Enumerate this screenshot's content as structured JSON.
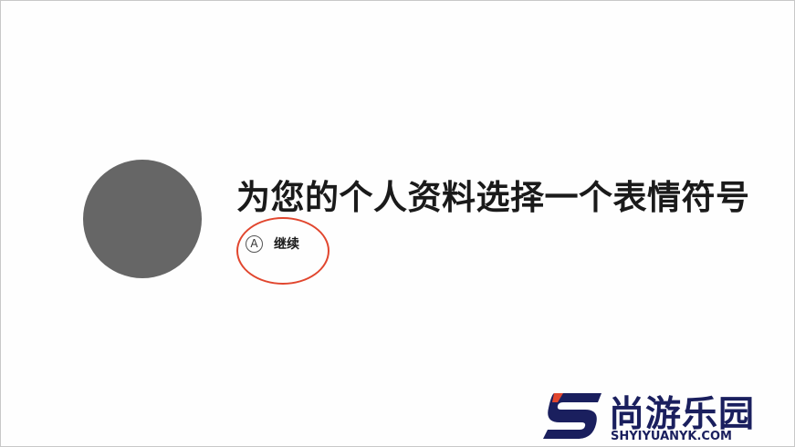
{
  "profile": {
    "title": "为您的个人资料选择一个表情符号",
    "continue": {
      "key_hint": "A",
      "label": "继续"
    }
  },
  "watermark": {
    "name": "尚游乐园",
    "url": "SHYIYUANYK.COM"
  },
  "colors": {
    "avatar": "#666666",
    "annotation": "#e1462e",
    "watermark_navy": "#1a1f5e",
    "watermark_accent": "#e1462e"
  }
}
